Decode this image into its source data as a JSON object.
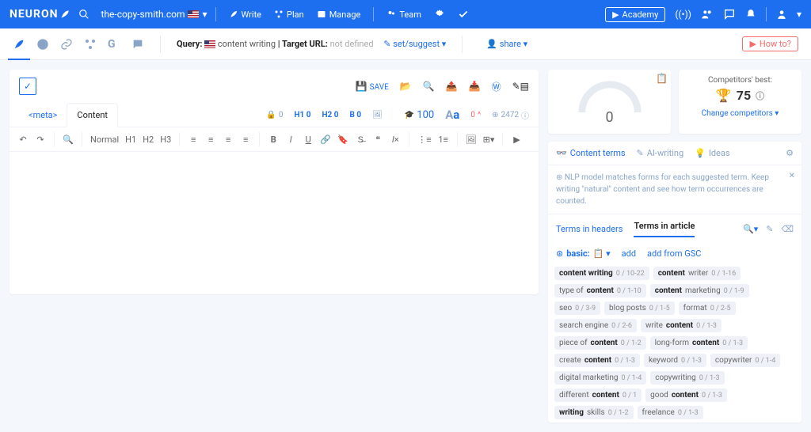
{
  "top": {
    "logo": "NEURON",
    "domain": "the-copy-smith.com",
    "nav": {
      "write": "Write",
      "plan": "Plan",
      "manage": "Manage",
      "team": "Team"
    },
    "academy": "Academy"
  },
  "sub": {
    "query_label": "Query:",
    "query_value": "content writing",
    "target_label": "Target URL:",
    "target_value": "not defined",
    "set_suggest": "set/suggest",
    "share": "share",
    "howto": "How to?"
  },
  "editor": {
    "save": "SAVE",
    "meta_tab": "<meta>",
    "content_tab": "Content",
    "metrics": {
      "h0": "0",
      "h1": "H1 0",
      "h2": "H2 0",
      "b": "B 0",
      "grad": "100",
      "score": "0",
      "chars": "2472"
    },
    "format": "Normal",
    "h1": "H1",
    "h2": "H2",
    "h3": "H3"
  },
  "right": {
    "gauge": "0",
    "comp_label": "Competitors' best:",
    "comp_val": "75",
    "change": "Change competitors",
    "tabs": {
      "content": "Content terms",
      "ai": "AI-writing",
      "ideas": "Ideas"
    },
    "nlp": "NLP model matches forms for each suggested term. Keep writing \"natural\" content and see how term occurrences are counted.",
    "sub": {
      "headers": "Terms in headers",
      "article": "Terms in article"
    },
    "basic": {
      "label": "basic:",
      "add": "add",
      "gsc": "add from GSC"
    }
  },
  "terms": [
    {
      "pre": "",
      "b": "content writing",
      "post": "",
      "c": "0 / 10-22"
    },
    {
      "pre": "",
      "b": "content",
      "post": " writer",
      "c": "0 / 1-16"
    },
    {
      "pre": "type of ",
      "b": "content",
      "post": "",
      "c": "0 / 1-10"
    },
    {
      "pre": "",
      "b": "content",
      "post": " marketing",
      "c": "0 / 1-9"
    },
    {
      "pre": "seo",
      "b": "",
      "post": "",
      "c": "0 / 3-9"
    },
    {
      "pre": "blog posts",
      "b": "",
      "post": "",
      "c": "0 / 1-5"
    },
    {
      "pre": "format",
      "b": "",
      "post": "",
      "c": "0 / 2-5"
    },
    {
      "pre": "search engine",
      "b": "",
      "post": "",
      "c": "0 / 2-6"
    },
    {
      "pre": "write ",
      "b": "content",
      "post": "",
      "c": "0 / 1-3"
    },
    {
      "pre": "piece of ",
      "b": "content",
      "post": "",
      "c": "0 / 1-2"
    },
    {
      "pre": "long-form ",
      "b": "content",
      "post": "",
      "c": "0 / 1-3"
    },
    {
      "pre": "create ",
      "b": "content",
      "post": "",
      "c": "0 / 1-3"
    },
    {
      "pre": "keyword",
      "b": "",
      "post": "",
      "c": "0 / 1-3"
    },
    {
      "pre": "copywriter",
      "b": "",
      "post": "",
      "c": "0 / 1-4"
    },
    {
      "pre": "digital marketing",
      "b": "",
      "post": "",
      "c": "0 / 1-4"
    },
    {
      "pre": "copywriting",
      "b": "",
      "post": "",
      "c": "0 / 1-3"
    },
    {
      "pre": "different ",
      "b": "content",
      "post": "",
      "c": "0 / 1"
    },
    {
      "pre": "good ",
      "b": "content",
      "post": "",
      "c": "0 / 1-3"
    },
    {
      "pre": "",
      "b": "writing",
      "post": " skills",
      "c": "0 / 1-2"
    },
    {
      "pre": "freelance",
      "b": "",
      "post": "",
      "c": "0 / 1-3"
    }
  ]
}
